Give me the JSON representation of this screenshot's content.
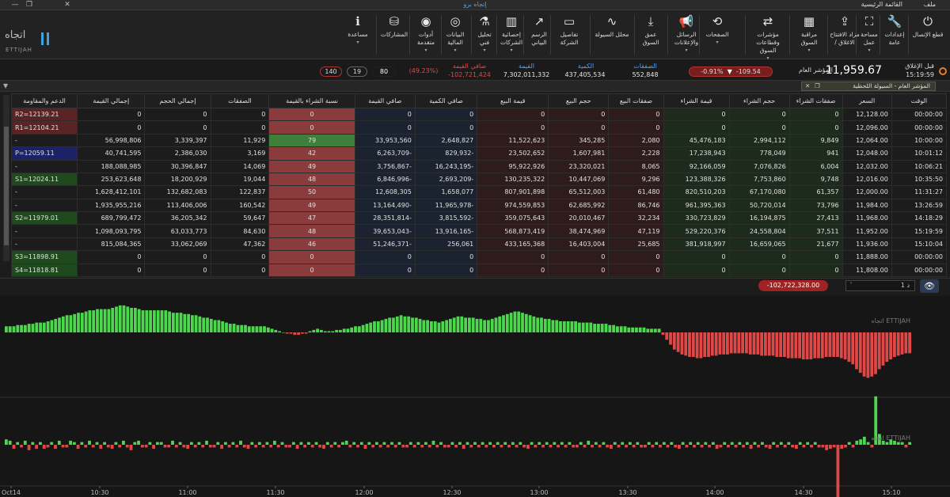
{
  "window": {
    "title": "إتجاه برو",
    "menu_main": "القائمة الرئيسية",
    "menu_file": "ملف",
    "min": "—",
    "restore": "❐",
    "close": "✕"
  },
  "logo": {
    "ar": "اتجاه",
    "en": "ETTIJAH"
  },
  "toolbar": [
    {
      "name": "disconnect",
      "icon": "power-icon",
      "glyph": "⏻",
      "label": "قطع الإتصال",
      "dd": ""
    },
    {
      "name": "general-settings",
      "icon": "wrench-icon",
      "glyph": "🔧",
      "label": "إعدادات\nعامة",
      "dd": ""
    },
    {
      "name": "workspace",
      "icon": "expand-icon",
      "glyph": "⛶",
      "label": "مساحة\nعمل",
      "dd": "▾"
    },
    {
      "name": "open-close-auction",
      "icon": "share-icon",
      "glyph": "⇪",
      "label": "مزاد الافتتاح\n/ الاغلاق",
      "dd": ""
    },
    {
      "name": "market-watch",
      "icon": "grid-icon",
      "glyph": "▦",
      "label": "مراقبة\nالسوق",
      "dd": "▾"
    },
    {
      "name": "indices-sectors",
      "icon": "shuffle-icon",
      "glyph": "⇄",
      "label": "مؤشرات\nوقطاعات السوق",
      "dd": "▾"
    },
    {
      "name": "pages",
      "icon": "refresh-icon",
      "glyph": "⟲",
      "label": "الصفحات",
      "dd": "▾"
    },
    {
      "name": "messages-ads",
      "icon": "megaphone-icon",
      "glyph": "📢",
      "label": "الرسائل\nوالإعلانات",
      "dd": "▾"
    },
    {
      "name": "market-depth",
      "icon": "download-icon",
      "glyph": "⤓",
      "label": "عمق السوق",
      "dd": ""
    },
    {
      "name": "liquidity-analyzer",
      "icon": "pulse-icon",
      "glyph": "∿",
      "label": "محلل السيولة",
      "dd": ""
    },
    {
      "name": "company-details",
      "icon": "document-icon",
      "glyph": "▭",
      "label": "تفاصيل\nالشركة",
      "dd": ""
    },
    {
      "name": "charts",
      "icon": "chart-line-icon",
      "glyph": "↗",
      "label": "الرسم\nالبياني",
      "dd": ""
    },
    {
      "name": "company-stats",
      "icon": "bar-chart-icon",
      "glyph": "▥",
      "label": "إحصائية\nالشركات",
      "dd": "▾"
    },
    {
      "name": "technical-analysis",
      "icon": "analysis-icon",
      "glyph": "⚗",
      "label": "تحليل\nفني",
      "dd": "▾"
    },
    {
      "name": "financial-data",
      "icon": "coins-icon",
      "glyph": "◎",
      "label": "البيانات\nالمالية",
      "dd": "▾"
    },
    {
      "name": "advanced-tools",
      "icon": "target-icon",
      "glyph": "◉",
      "label": "أدوات\nمتقدمة",
      "dd": "▾"
    },
    {
      "name": "participations",
      "icon": "stack-icon",
      "glyph": "⛁",
      "label": "المشاركات",
      "dd": ""
    },
    {
      "name": "help",
      "icon": "info-icon",
      "glyph": "ℹ",
      "label": "مساعدة",
      "dd": "▾"
    }
  ],
  "summary": {
    "prev_close_label": "قبل الإغلاق",
    "time": "15:19:59",
    "index_label": "المؤشر العام",
    "index_value": "11,959.67",
    "change_pts": "-109.54",
    "change_pct": "-0.91%",
    "deals_label": "الصفقات",
    "deals": "552,848",
    "qty_label": "الكمية",
    "qty": "437,405,534",
    "value_label": "القيمة",
    "value": "7,302,011,332",
    "net_value_label": "صافي القيمة",
    "net_value": "-102,721,424",
    "net_pct": "(49.23%)",
    "count_a": "80",
    "count_b": "19",
    "count_c": "140"
  },
  "panel": {
    "tab_title": "المؤشر العام - السيولة اللحظية"
  },
  "table": {
    "headers": [
      "الوقت",
      "السعر",
      "صفقات الشراء",
      "حجم الشراء",
      "قيمة الشراء",
      "صفقات البيع",
      "حجم البيع",
      "قيمة البيع",
      "صافي الكمية",
      "صافي القيمة",
      "نسبة الشراء بالقيمة",
      "الصفقات",
      "إجمالي الحجم",
      "إجمالي القيمة",
      "الدعم والمقاومة"
    ],
    "rows": [
      [
        "00:00:00",
        "12,128.00",
        "0",
        "0",
        "0",
        "0",
        "0",
        "0",
        "0",
        "0",
        "0",
        "0",
        "0",
        "0",
        "R2=12139.21"
      ],
      [
        "00:00:00",
        "12,096.00",
        "0",
        "0",
        "0",
        "0",
        "0",
        "0",
        "0",
        "0",
        "0",
        "0",
        "0",
        "0",
        "R1=12104.21"
      ],
      [
        "10:00:00",
        "12,064.00",
        "9,849",
        "2,994,112",
        "45,476,183",
        "2,080",
        "345,285",
        "11,522,623",
        "2,648,827",
        "33,953,560",
        "79",
        "11,929",
        "3,339,397",
        "56,998,806",
        "-"
      ],
      [
        "10:01:12",
        "12,048.00",
        "941",
        "778,049",
        "17,238,943",
        "2,228",
        "1,607,981",
        "23,502,652",
        "-829,932",
        "-6,263,709",
        "42",
        "3,169",
        "2,386,030",
        "40,741,595",
        "P=12059.11"
      ],
      [
        "10:06:21",
        "12,032.00",
        "6,004",
        "7,076,826",
        "92,166,059",
        "8,065",
        "23,320,021",
        "95,922,926",
        "-16,243,195",
        "-3,756,867",
        "49",
        "14,069",
        "30,396,847",
        "188,088,985",
        "-"
      ],
      [
        "10:35:50",
        "12,016.00",
        "9,748",
        "7,753,860",
        "123,388,326",
        "9,296",
        "10,447,069",
        "130,235,322",
        "-2,693,209",
        "-6,846,996",
        "48",
        "19,044",
        "18,200,929",
        "253,623,648",
        "S1=12024.11"
      ],
      [
        "11:31:27",
        "12,000.00",
        "61,357",
        "67,170,080",
        "820,510,203",
        "61,480",
        "65,512,003",
        "807,901,898",
        "1,658,077",
        "12,608,305",
        "50",
        "122,837",
        "132,682,083",
        "1,628,412,101",
        "-"
      ],
      [
        "13:26:59",
        "11,984.00",
        "73,796",
        "50,720,014",
        "961,395,363",
        "86,746",
        "62,685,992",
        "974,559,853",
        "-11,965,978",
        "-13,164,490",
        "49",
        "160,542",
        "113,406,006",
        "1,935,955,216",
        "-"
      ],
      [
        "14:18:29",
        "11,968.00",
        "27,413",
        "16,194,875",
        "330,723,829",
        "32,234",
        "20,010,467",
        "359,075,643",
        "-3,815,592",
        "-28,351,814",
        "47",
        "59,647",
        "36,205,342",
        "689,799,472",
        "S2=11979.01"
      ],
      [
        "15:19:59",
        "11,952.00",
        "37,511",
        "24,558,804",
        "529,220,376",
        "47,119",
        "38,474,969",
        "568,873,419",
        "-13,916,165",
        "-39,653,043",
        "48",
        "84,630",
        "63,033,773",
        "1,098,093,795",
        "-"
      ],
      [
        "15:10:04",
        "11,936.00",
        "21,677",
        "16,659,065",
        "381,918,997",
        "25,685",
        "16,403,004",
        "433,165,368",
        "256,061",
        "-51,246,371",
        "46",
        "47,362",
        "33,062,069",
        "815,084,365",
        "-"
      ],
      [
        "00:00:00",
        "11,888.00",
        "0",
        "0",
        "0",
        "0",
        "0",
        "0",
        "0",
        "0",
        "0",
        "0",
        "0",
        "0",
        "S3=11898.91"
      ],
      [
        "00:00:00",
        "11,808.00",
        "0",
        "0",
        "0",
        "0",
        "0",
        "0",
        "0",
        "0",
        "0",
        "0",
        "0",
        "0",
        "S4=11818.81"
      ]
    ]
  },
  "midbar": {
    "total_net": "-102,722,328.00",
    "period": "1 د"
  },
  "chart_data": [
    {
      "type": "bar",
      "title": "",
      "xlabel": "",
      "ylabel": "",
      "x_ticks": [
        "Oct14",
        "10:30",
        "11:00",
        "11:30",
        "12:00",
        "12:30",
        "13:00",
        "13:30",
        "14:00",
        "14:30",
        "15:10"
      ],
      "note_series": "cumulative net liquidity (green positive, red negative)",
      "values": [
        5,
        5,
        5,
        6,
        6,
        6,
        7,
        7,
        8,
        8,
        8,
        9,
        10,
        11,
        12,
        13,
        14,
        14,
        15,
        16,
        16,
        17,
        18,
        18,
        19,
        19,
        19,
        19,
        20,
        21,
        22,
        22,
        21,
        20,
        20,
        19,
        18,
        18,
        18,
        18,
        18,
        18,
        18,
        17,
        16,
        16,
        16,
        15,
        15,
        14,
        14,
        13,
        12,
        12,
        11,
        10,
        10,
        9,
        8,
        7,
        7,
        6,
        6,
        6,
        5,
        5,
        5,
        5,
        5,
        4,
        3,
        2,
        1,
        0,
        -1,
        -1,
        -2,
        -2,
        -1,
        -1,
        1,
        2,
        3,
        2,
        1,
        1,
        1,
        2,
        2,
        3,
        3,
        4,
        5,
        5,
        6,
        7,
        8,
        9,
        9,
        10,
        11,
        12,
        12,
        13,
        14,
        13,
        13,
        12,
        12,
        11,
        10,
        10,
        9,
        9,
        8,
        9,
        10,
        11,
        12,
        13,
        13,
        12,
        12,
        12,
        11,
        11,
        10,
        10,
        11,
        12,
        13,
        14,
        15,
        16,
        17,
        17,
        16,
        15,
        14,
        13,
        12,
        12,
        11,
        11,
        10,
        10,
        9,
        9,
        9,
        9,
        9,
        8,
        8,
        8,
        8,
        7,
        7,
        7,
        7,
        6,
        6,
        5,
        5,
        5,
        4,
        4,
        4,
        4,
        4,
        3,
        3,
        3,
        3,
        -2,
        -6,
        -10,
        -14,
        -16,
        -18,
        -19,
        -20,
        -20,
        -21,
        -21,
        -20,
        -20,
        -19,
        -19,
        -18,
        -18,
        -18,
        -17,
        -17,
        -17,
        -17,
        -17,
        -18,
        -18,
        -18,
        -19,
        -19,
        -19,
        -19,
        -20,
        -20,
        -20,
        -21,
        -21,
        -21,
        -21,
        -22,
        -22,
        -22,
        -21,
        -21,
        -21,
        -20,
        -20,
        -20,
        -20,
        -21,
        -22,
        -24,
        -26,
        -30,
        -33,
        -36,
        -37,
        -36,
        -34,
        -30,
        -27,
        -24,
        -22,
        -20,
        -19,
        -18,
        -17,
        -17
      ]
    },
    {
      "type": "bar",
      "title": "",
      "xlabel": "",
      "ylabel": "",
      "note_series": "per-minute net value (green positive, red negative)",
      "values": [
        4,
        3,
        -3,
        2,
        -2,
        3,
        -4,
        2,
        -3,
        2,
        -3,
        -2,
        2,
        -3,
        3,
        -2,
        -2,
        3,
        2,
        -3,
        2,
        -2,
        3,
        -2,
        2,
        -3,
        2,
        -2,
        -3,
        2,
        -2,
        3,
        -2,
        -4,
        2,
        3,
        -2,
        -2,
        2,
        -3,
        2,
        2,
        -2,
        -2,
        3,
        -2,
        2,
        -2,
        -3,
        2,
        -2,
        2,
        -2,
        3,
        -2,
        -2,
        2,
        -3,
        2,
        -2,
        2,
        -2,
        3,
        -2,
        -3,
        2,
        -2,
        2,
        -2,
        2,
        -2,
        3,
        -2,
        2,
        -2,
        -2,
        2,
        -3,
        2,
        -2,
        2,
        -2,
        2,
        -2,
        -3,
        2,
        -2,
        2,
        -2,
        2,
        3,
        -2,
        2,
        -2,
        2,
        -3,
        2,
        -2,
        2,
        -2,
        2,
        -2,
        2,
        -2,
        2,
        -2,
        -2,
        2,
        -2,
        2,
        -2,
        2,
        -2,
        3,
        -2,
        2,
        -2,
        -2,
        2,
        -2,
        2,
        -3,
        2,
        -2,
        2,
        -2,
        2,
        -2,
        2,
        -2,
        2,
        -2,
        2,
        -2,
        2,
        -2,
        2,
        -2,
        -3,
        2,
        -2,
        2,
        -2,
        2,
        -2,
        2,
        -2,
        2,
        -2,
        2,
        -2,
        -2,
        2,
        -2,
        3,
        -2,
        2,
        -2,
        2,
        -2,
        -3,
        2,
        -2,
        2,
        -2,
        2,
        -2,
        2,
        -2,
        -2,
        2,
        -2,
        2,
        -2,
        2,
        -2,
        2,
        -2,
        -3,
        2,
        -2,
        2,
        -2,
        2,
        -2,
        2,
        -2,
        2,
        -3,
        -2,
        2,
        -2,
        2,
        -2,
        2,
        -2,
        2,
        -3,
        2,
        -2,
        2,
        -2,
        -3,
        2,
        -2,
        2,
        -2,
        2,
        -2,
        -3,
        2,
        -2,
        2,
        -2,
        2,
        -2,
        -2,
        -4,
        -3,
        -2,
        -50,
        -3,
        -2,
        2,
        -2,
        3,
        4,
        6,
        2,
        -2,
        36,
        8,
        3,
        2,
        4,
        3,
        2,
        2,
        -2,
        2
      ]
    }
  ],
  "colors": {
    "pos": "#4cd84c",
    "neg": "#e04848",
    "accent": "#4aa3ff",
    "pill_red": "#a02222"
  }
}
